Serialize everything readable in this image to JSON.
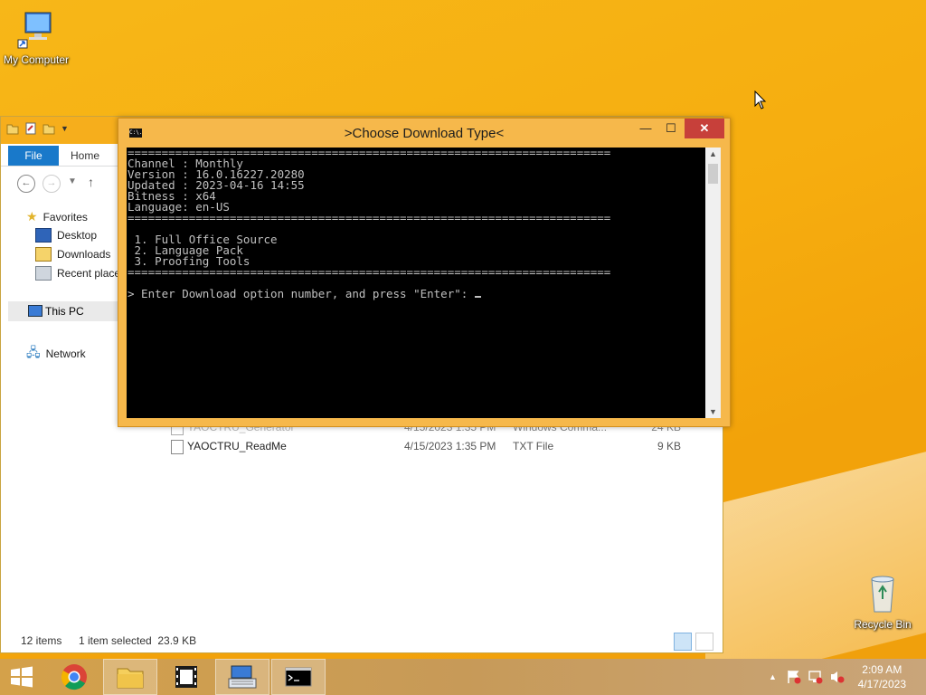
{
  "desktop": {
    "icons": [
      {
        "label": "My Computer"
      },
      {
        "label": "Recycle Bin"
      }
    ]
  },
  "explorer": {
    "ribbon": {
      "file_tab": "File",
      "home_tab": "Home"
    },
    "nav": {
      "favorites": "Favorites",
      "desktop": "Desktop",
      "downloads": "Downloads",
      "recent": "Recent places",
      "this_pc": "This PC",
      "network": "Network"
    },
    "files": [
      {
        "name": "YAOCTRU_Generator",
        "date": "4/15/2023 1:35 PM",
        "type": "Windows Comma...",
        "size": "24 KB"
      },
      {
        "name": "YAOCTRU_ReadMe",
        "date": "4/15/2023 1:35 PM",
        "type": "TXT File",
        "size": "9 KB"
      }
    ],
    "status": {
      "items": "12 items",
      "selected": "1 item selected  23.9 KB"
    }
  },
  "console": {
    "title": ">Choose Download Type<",
    "icon_text": "C:\\.",
    "lines": [
      "=======================================================================",
      "Channel : Monthly",
      "Version : 16.0.16227.20280",
      "Updated : 2023-04-16 14:55",
      "Bitness : x64",
      "Language: en-US",
      "=======================================================================",
      "",
      " 1. Full Office Source",
      " 2. Language Pack",
      " 3. Proofing Tools",
      "======================================================================="
    ],
    "prompt": "> Enter Download option number, and press \"Enter\": "
  },
  "taskbar": {
    "clock_time": "2:09 AM",
    "clock_date": "4/17/2023"
  },
  "colors": {
    "wallpaper": "#f6ad0f",
    "file_tab": "#1979ca",
    "console_frame": "#f6b84b",
    "close_button": "#c7403a"
  }
}
